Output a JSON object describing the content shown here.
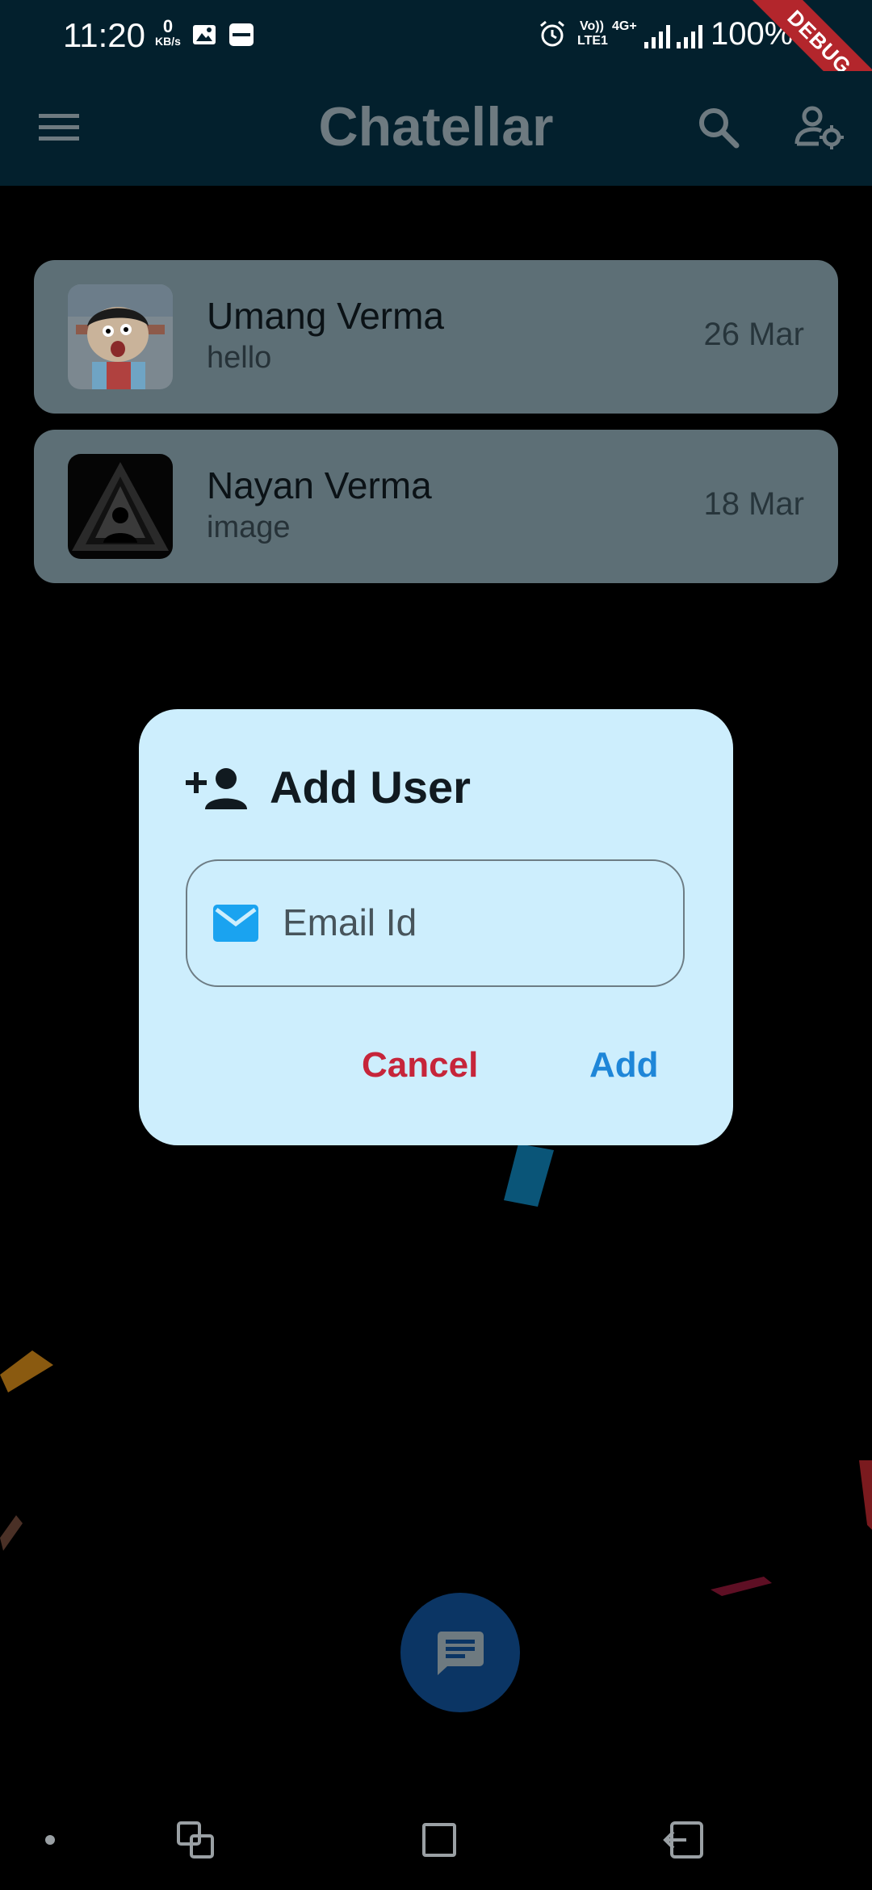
{
  "status_bar": {
    "time": "11:20",
    "net_speed_value": "0",
    "net_speed_unit": "KB/s",
    "volte_label": "Vo)) LTE1",
    "network_label": "4G+",
    "battery": "100%",
    "debug_banner": "DEBUG"
  },
  "app_bar": {
    "title": "Chatellar",
    "icons": [
      "menu-icon",
      "search-icon",
      "user-settings-icon"
    ]
  },
  "chats": [
    {
      "name": "Umang Verma",
      "last_message": "hello",
      "date": "26 Mar"
    },
    {
      "name": "Nayan Verma",
      "last_message": "image",
      "date": "18 Mar"
    }
  ],
  "dialog": {
    "title": "Add User",
    "email_placeholder": "Email Id",
    "email_value": "",
    "cancel_label": "Cancel",
    "add_label": "Add"
  },
  "colors": {
    "app_bar": "#03202d",
    "chat_card": "#5d6f76",
    "dialog_bg": "#cdeefd",
    "cancel": "#c6253a",
    "add": "#1e86d8",
    "mail_icon": "#1aa3f0",
    "fab": "#0b3564"
  }
}
